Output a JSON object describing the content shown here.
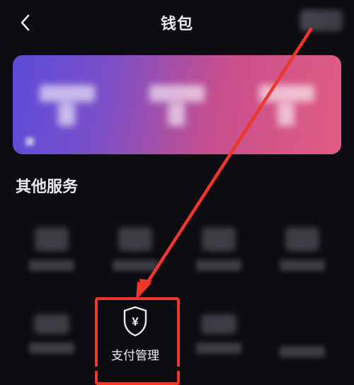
{
  "header": {
    "title": "钱包"
  },
  "section": {
    "other_services_title": "其他服务"
  },
  "services_row2": {
    "payment_management_label": "支付管理"
  }
}
